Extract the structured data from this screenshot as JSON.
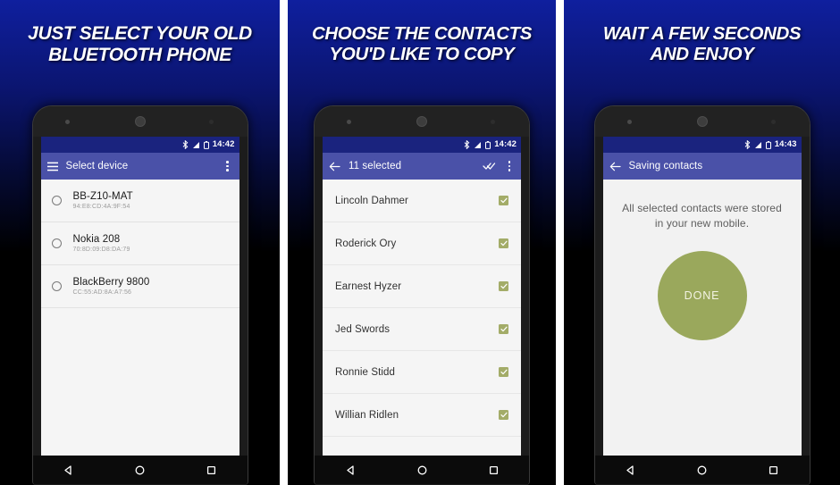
{
  "panels": [
    {
      "caption": "JUST SELECT YOUR OLD\nBLUETOOTH PHONE",
      "status": {
        "time": "14:42"
      },
      "appbar": {
        "title": "Select device",
        "left_icon": "hamburger-menu-icon",
        "overflow": "overflow-menu-icon"
      },
      "devices": [
        {
          "name": "BB-Z10-MAT",
          "mac": "94:E8:CD:4A:9F:54"
        },
        {
          "name": "Nokia 208",
          "mac": "70:8D:09:D8:DA:79"
        },
        {
          "name": "BlackBerry 9800",
          "mac": "CC:55:AD:8A:A7:56"
        }
      ]
    },
    {
      "caption": "CHOOSE THE CONTACTS\nYOU'D LIKE TO COPY",
      "status": {
        "time": "14:42"
      },
      "appbar": {
        "title": "11 selected",
        "left_icon": "back-arrow-icon",
        "select_all": "select-all-icon",
        "overflow": "overflow-menu-icon"
      },
      "contacts": [
        {
          "name": "Lincoln Dahmer",
          "checked": true
        },
        {
          "name": "Roderick Ory",
          "checked": true
        },
        {
          "name": "Earnest Hyzer",
          "checked": true
        },
        {
          "name": "Jed Swords",
          "checked": true
        },
        {
          "name": "Ronnie Stidd",
          "checked": true
        },
        {
          "name": "Willian Ridlen",
          "checked": true
        }
      ]
    },
    {
      "caption": "WAIT A FEW SECONDS\nAND ENJOY",
      "status": {
        "time": "14:43"
      },
      "appbar": {
        "title": "Saving contacts",
        "left_icon": "back-arrow-icon"
      },
      "saving": {
        "message": "All selected contacts were stored in your new mobile.",
        "button_label": "DONE"
      }
    }
  ],
  "navbar": {
    "back": "back-triangle-icon",
    "home": "home-circle-icon",
    "recents": "recents-square-icon"
  },
  "colors": {
    "statusbar": "#1a237e",
    "appbar": "#4a51a8",
    "checkbox": "#a3ac68",
    "done_button": "#9aa85c",
    "caption_text": "#ffffff"
  }
}
